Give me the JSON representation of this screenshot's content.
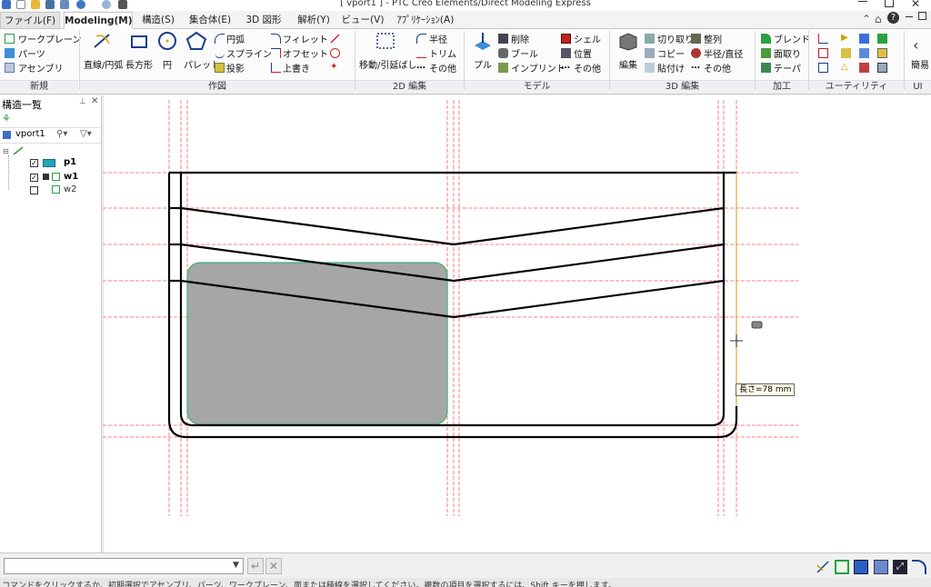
{
  "window": {
    "title": "[ vport1 ] - PTC Creo Elements/Direct Modeling Express"
  },
  "tabs": [
    {
      "label": "ファイル(F)"
    },
    {
      "label": "Modeling(M)"
    },
    {
      "label": "構造(S)"
    },
    {
      "label": "集合体(E)"
    },
    {
      "label": "3D 図形"
    },
    {
      "label": "解析(Y)"
    },
    {
      "label": "ビュー(V)"
    },
    {
      "label": "ｱﾌﾟﾘｹｰｼｮﾝ(A)"
    }
  ],
  "ribbon": {
    "new": {
      "workplane": "ワークプレーン",
      "parts": "パーツ",
      "assembly": "アセンブリ",
      "group": "新規"
    },
    "draw": {
      "line": "直線/円弧",
      "rect": "長方形",
      "circle": "円",
      "palette": "パレット",
      "arc": "円弧",
      "spline": "スプライン",
      "project": "投影",
      "fillet": "フィレット",
      "offset": "オフセット",
      "overwrite": "上書き",
      "group": "作図"
    },
    "edit2d": {
      "move": "移動/引延ばし",
      "radius": "半径",
      "trim": "トリム",
      "other": "その他",
      "group": "2D 編集"
    },
    "model": {
      "pull": "プル",
      "delete": "削除",
      "bool": "ブール",
      "imprint": "インプリント",
      "shell": "シェル",
      "position": "位置",
      "other": "その他",
      "group": "モデル"
    },
    "edit3d": {
      "edit": "編集",
      "cut": "切り取り",
      "copy": "コピー",
      "paste": "貼付け",
      "align": "整列",
      "radius_dia": "半径/直径",
      "other": "その他",
      "group": "3D 編集"
    },
    "machining": {
      "blend": "ブレンド",
      "chamfer": "面取り",
      "taper": "テーパ",
      "group": "加工"
    },
    "utility": {
      "group": "ユーティリティ"
    },
    "ui": {
      "simple": "簡易",
      "group": "UI"
    }
  },
  "panel": {
    "title": "構造一覧",
    "vport": "vport1",
    "tree": [
      {
        "label": "p1",
        "checked": true
      },
      {
        "label": "w1",
        "checked": true
      },
      {
        "label": "w2",
        "checked": false
      }
    ]
  },
  "canvas": {
    "tooltip": "長さ=78 mm"
  },
  "status": {
    "message": "コマンドをクリックするか、初期選択でアセンブリ、パーツ、ワークプレーン、面または稜線を選択してください。複数の項目を選択するには、Shift キーを押します。"
  },
  "colors": {
    "construction_line": "#ff4a4a",
    "profile": "#000000",
    "face_fill": "#a6a6a6",
    "face_edge": "#3cb371",
    "accent": "#2e6bd8"
  }
}
